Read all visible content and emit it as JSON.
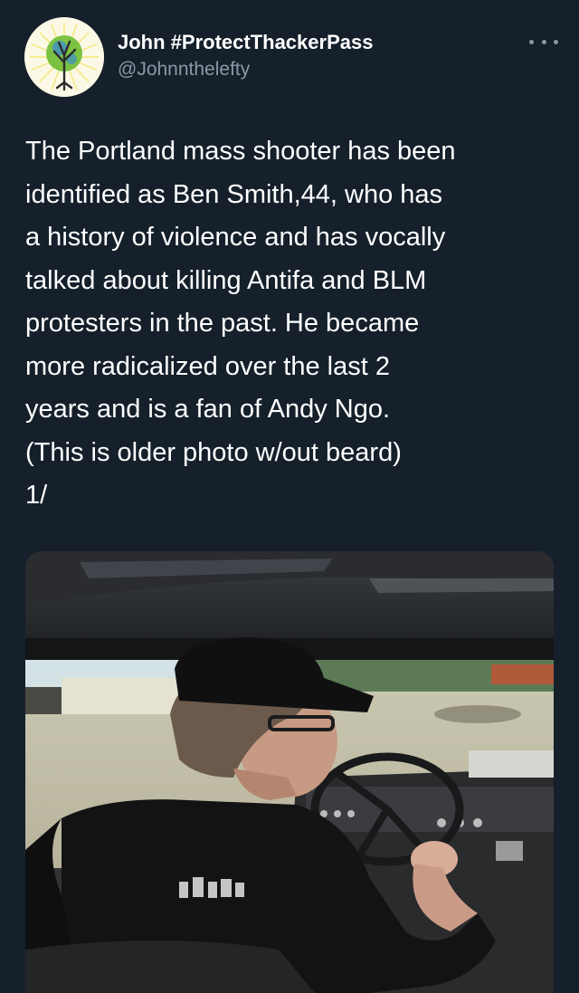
{
  "tweet": {
    "author": {
      "display_name": "John #ProtectThackerPass",
      "handle": "@Johnnthelefty",
      "avatar_icon": "tree-globe-avatar-icon"
    },
    "more_icon": "more-options-icon",
    "text": "The Portland mass shooter has been\nidentified as Ben Smith,44, who has\na history of violence and has vocally\ntalked about killing Antifa and BLM\nprotesters in the past. He became\nmore radicalized over the last 2\nyears and is a fan of Andy Ngo.\n(This is older photo w/out beard)\n1/",
    "media": {
      "description_icon": "photo-man-driving-car"
    }
  },
  "colors": {
    "background": "#15202b",
    "text_primary": "#ffffff",
    "text_secondary": "#8b98a5"
  }
}
